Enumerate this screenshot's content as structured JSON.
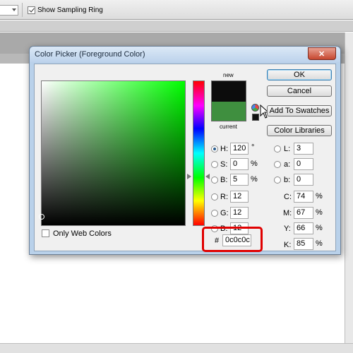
{
  "options_bar": {
    "sampling_ring_label": "Show Sampling Ring",
    "sampling_ring_checked": true
  },
  "dialog": {
    "title": "Color Picker (Foreground Color)",
    "close_glyph": "✕",
    "new_label": "new",
    "current_label": "current",
    "new_color": "#0c0c0c",
    "current_color": "#3f8f3f",
    "buttons": {
      "ok": "OK",
      "cancel": "Cancel",
      "add_to_swatches": "Add To Swatches",
      "color_libraries": "Color Libraries"
    },
    "hsb": {
      "h": {
        "label": "H:",
        "value": "120",
        "unit": "°",
        "selected": true
      },
      "s": {
        "label": "S:",
        "value": "0",
        "unit": "%"
      },
      "b": {
        "label": "B:",
        "value": "5",
        "unit": "%"
      }
    },
    "rgb": {
      "r": {
        "label": "R:",
        "value": "12"
      },
      "g": {
        "label": "G:",
        "value": "12"
      },
      "b": {
        "label": "B:",
        "value": "12"
      }
    },
    "lab": {
      "l": {
        "label": "L:",
        "value": "3"
      },
      "a": {
        "label": "a:",
        "value": "0"
      },
      "b": {
        "label": "b:",
        "value": "0"
      }
    },
    "cmyk": {
      "c": {
        "label": "C:",
        "value": "74",
        "unit": "%"
      },
      "m": {
        "label": "M:",
        "value": "67",
        "unit": "%"
      },
      "y": {
        "label": "Y:",
        "value": "66",
        "unit": "%"
      },
      "k": {
        "label": "K:",
        "value": "85",
        "unit": "%"
      }
    },
    "hex": {
      "label": "#",
      "value": "0c0c0c"
    },
    "only_web_colors": {
      "label": "Only Web Colors",
      "checked": false
    }
  }
}
